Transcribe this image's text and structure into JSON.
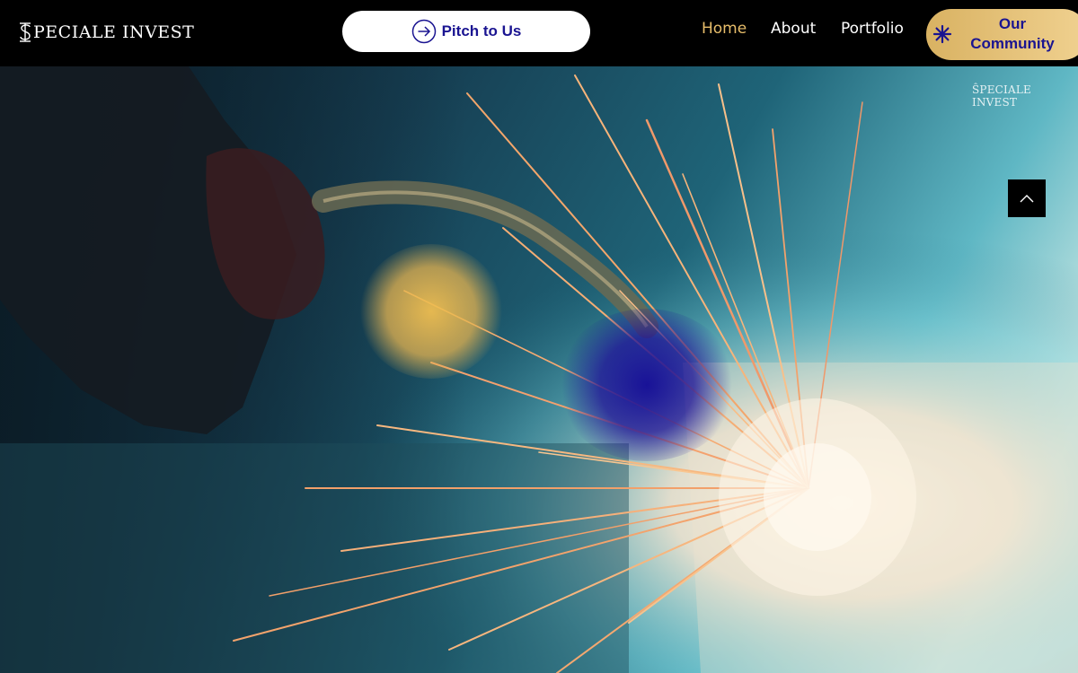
{
  "brand": {
    "logo_text": "PECIALE INVEST",
    "logo_full": "SPECIALE INVEST",
    "watermark_text": "PECIALE INVEST"
  },
  "header": {
    "pitch_button_label": "Pitch to Us",
    "pitch_icon": "arrow-right-circle-icon",
    "nav": [
      {
        "label": "Home",
        "active": true
      },
      {
        "label": "About",
        "active": false
      },
      {
        "label": "Portfolio",
        "active": false
      }
    ],
    "community_button_label": "Our Community",
    "community_icon": "asterisk-star-icon"
  },
  "hero": {
    "scene": "welding-sparks",
    "scroll_top_icon": "chevron-up-icon"
  },
  "colors": {
    "header_bg": "#000000",
    "nav_active": "#e7bd6a",
    "brand_blue": "#1a1491",
    "gold": "#e2be74"
  }
}
